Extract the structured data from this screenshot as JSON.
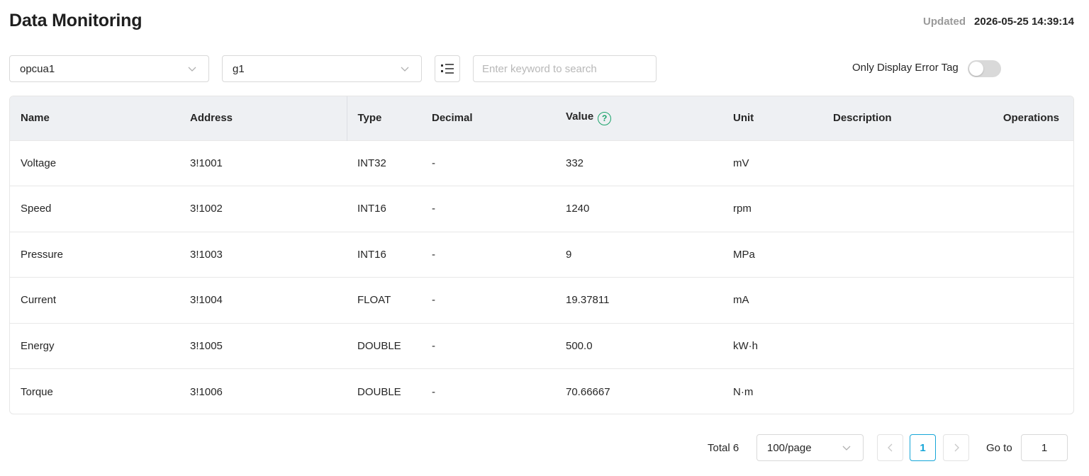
{
  "header": {
    "title": "Data Monitoring",
    "updated_label": "Updated",
    "updated_value": "2026-05-25 14:39:14"
  },
  "filters": {
    "node_select": "opcua1",
    "group_select": "g1",
    "search_placeholder": "Enter keyword to search",
    "search_value": "",
    "error_toggle_label": "Only Display Error Tag",
    "error_toggle_on": false
  },
  "table": {
    "columns": [
      "Name",
      "Address",
      "Type",
      "Decimal",
      "Value",
      "Unit",
      "Description",
      "Operations"
    ],
    "rows": [
      {
        "name": "Voltage",
        "address": "3!1001",
        "type": "INT32",
        "decimal": "-",
        "value": "332",
        "unit": "mV",
        "description": ""
      },
      {
        "name": "Speed",
        "address": "3!1002",
        "type": "INT16",
        "decimal": "-",
        "value": "1240",
        "unit": "rpm",
        "description": ""
      },
      {
        "name": "Pressure",
        "address": "3!1003",
        "type": "INT16",
        "decimal": "-",
        "value": "9",
        "unit": "MPa",
        "description": ""
      },
      {
        "name": "Current",
        "address": "3!1004",
        "type": "FLOAT",
        "decimal": "-",
        "value": "19.37811",
        "unit": "mA",
        "description": ""
      },
      {
        "name": "Energy",
        "address": "3!1005",
        "type": "DOUBLE",
        "decimal": "-",
        "value": "500.0",
        "unit": "kW·h",
        "description": ""
      },
      {
        "name": "Torque",
        "address": "3!1006",
        "type": "DOUBLE",
        "decimal": "-",
        "value": "70.66667",
        "unit": "N·m",
        "description": ""
      }
    ]
  },
  "pagination": {
    "total_label": "Total 6",
    "page_size": "100/page",
    "current_page": "1",
    "goto_label": "Go to",
    "goto_value": "1"
  },
  "colors": {
    "accent": "#16a6d8",
    "help_icon": "#1aa36a",
    "header_bg": "#eef0f3"
  },
  "icons": {
    "help": "question-circle-icon",
    "list_view": "list-icon",
    "dropdown": "chevron-down-icon"
  }
}
